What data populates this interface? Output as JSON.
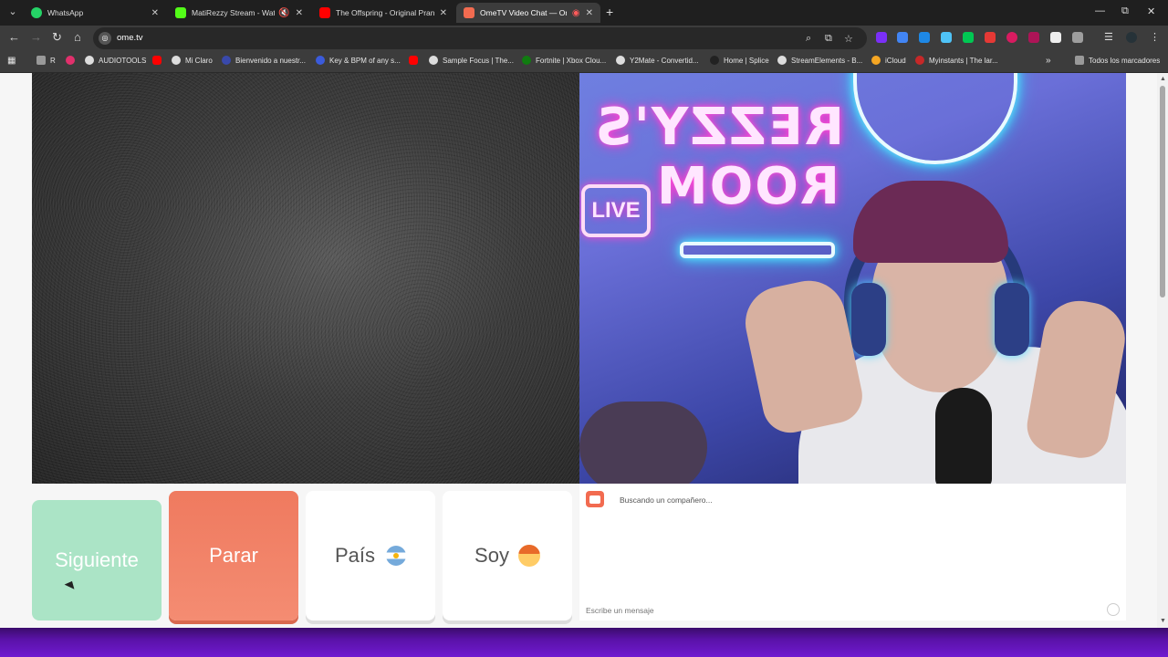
{
  "tabs": [
    {
      "title": "WhatsApp",
      "color": "#25d366"
    },
    {
      "title": "MatiRezzy Stream - Watch L",
      "color": "#53fc18"
    },
    {
      "title": "The Offspring - Original Pranksi",
      "color": "#ff0000"
    },
    {
      "title": "OmeTV Video Chat — Onl",
      "color": "#f26b50"
    }
  ],
  "window_controls": {
    "minimize": "—",
    "restore": "⧉",
    "close": "✕"
  },
  "address": {
    "url": "ome.tv"
  },
  "bookmarks": {
    "items": [
      {
        "label": "R",
        "color": "#999999"
      },
      {
        "label": "",
        "color": "#e1306c"
      },
      {
        "label": "AUDIOTOOLS",
        "color": "#dddddd"
      },
      {
        "label": "",
        "color": "#ff0000"
      },
      {
        "label": "Mi Claro",
        "color": "#dddddd"
      },
      {
        "label": "Bienvenido a nuestr...",
        "color": "#dddddd"
      },
      {
        "label": "Key & BPM of any s...",
        "color": "#3b5bdb"
      },
      {
        "label": "",
        "color": "#ff0000"
      },
      {
        "label": "Sample Focus | The...",
        "color": "#dddddd"
      },
      {
        "label": "Fortnite | Xbox Clou...",
        "color": "#107c10"
      },
      {
        "label": "Y2Mate - Convertid...",
        "color": "#dddddd"
      },
      {
        "label": "Home | Splice",
        "color": "#222222"
      },
      {
        "label": "StreamElements - B...",
        "color": "#dddddd"
      },
      {
        "label": "iCloud",
        "color": "#f5a623"
      },
      {
        "label": "Myinstants | The lar...",
        "color": "#c62828"
      }
    ],
    "all_bookmarks": "Todos los marcadores"
  },
  "stream": {
    "sign_line1": "REZZY'S",
    "sign_line2": "ROOM",
    "sign_live": "LIVE"
  },
  "controls": {
    "next_label": "Siguiente",
    "stop_label": "Parar",
    "country_label": "País",
    "me_label": "Soy"
  },
  "chat": {
    "status": "Buscando un compañero...",
    "placeholder": "Escribe un mensaje"
  }
}
